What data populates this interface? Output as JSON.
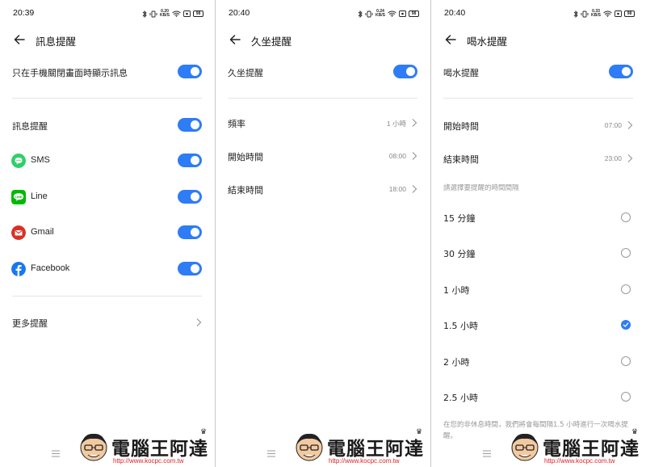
{
  "colors": {
    "accent": "#2e7cf6",
    "sms": "#2fcf6a",
    "line": "#00b900",
    "gmail": "#d93025",
    "facebook": "#1877f2"
  },
  "screens": [
    {
      "status_time": "20:39",
      "net_speed_value": "0.20",
      "net_speed_unit": "KB/S",
      "battery": "98",
      "title": "訊息提醒",
      "screen_only_label": "只在手機關閉畫面時顯示訊息",
      "message_reminder_label": "訊息提醒",
      "apps": [
        {
          "name": "SMS",
          "icon": "sms-icon"
        },
        {
          "name": "Line",
          "icon": "line-icon"
        },
        {
          "name": "Gmail",
          "icon": "gmail-icon"
        },
        {
          "name": "Facebook",
          "icon": "facebook-icon"
        }
      ],
      "more_label": "更多提醒"
    },
    {
      "status_time": "20:40",
      "net_speed_value": "0.24",
      "net_speed_unit": "KB/S",
      "battery": "98",
      "title": "久坐提醒",
      "toggle_label": "久坐提醒",
      "rows": [
        {
          "label": "頻率",
          "value": "1 小時"
        },
        {
          "label": "開始時間",
          "value": "08:00"
        },
        {
          "label": "結束時間",
          "value": "18:00"
        }
      ]
    },
    {
      "status_time": "20:40",
      "net_speed_value": "0.33",
      "net_speed_unit": "KB/S",
      "battery": "98",
      "title": "喝水提醒",
      "toggle_label": "喝水提醒",
      "rows": [
        {
          "label": "開始時間",
          "value": "07:00"
        },
        {
          "label": "結束時間",
          "value": "23:00"
        }
      ],
      "interval_hint": "請選擇要提醒的時間間隔",
      "intervals": [
        "15 分鐘",
        "30 分鐘",
        "1 小時",
        "1.5 小時",
        "2 小時",
        "2.5 小時"
      ],
      "selected_interval": "1.5 小時",
      "footer_note": "在您的非休息時間，我們將會每間隔1.5 小時進行一次喝水提醒。"
    }
  ],
  "watermark": {
    "brand": "電腦王阿達",
    "url": "http://www.kocpc.com.tw"
  }
}
